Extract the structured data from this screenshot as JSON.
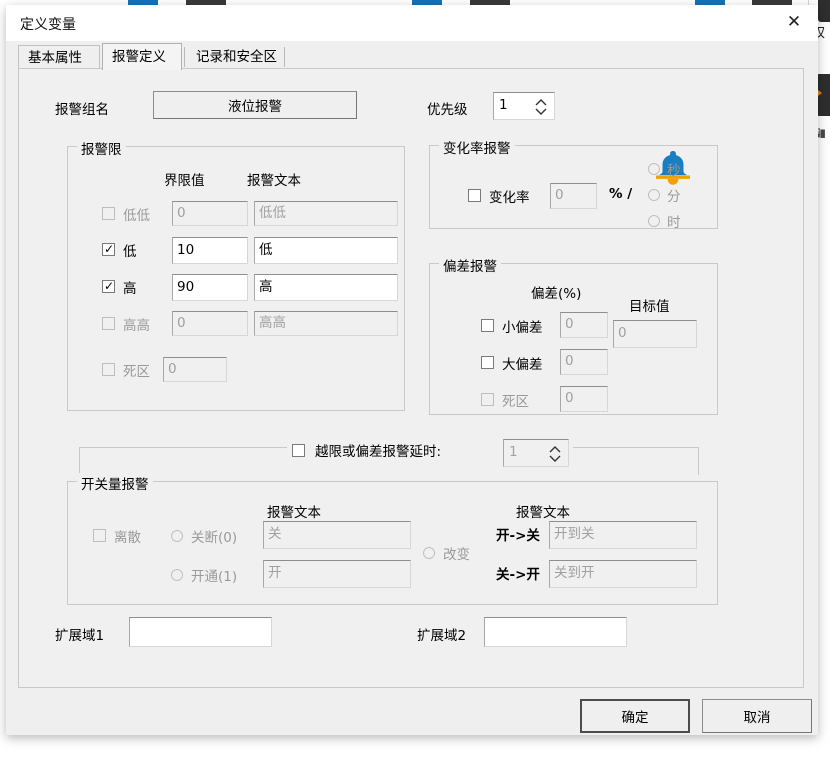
{
  "window": {
    "title": "定义变量",
    "close_icon": "close-icon"
  },
  "tabs": [
    {
      "label": "基本属性",
      "selected": false
    },
    {
      "label": "报警定义",
      "selected": true
    },
    {
      "label": "记录和安全区",
      "selected": false
    }
  ],
  "header": {
    "group_name_label": "报警组名",
    "group_name_button": "液位报警",
    "priority_label": "优先级",
    "priority_value": "1",
    "bell_icon": "bell-icon",
    "bell_top_color": "#1a7ec4",
    "bell_bottom_color": "#f2a007"
  },
  "alarm_limits": {
    "title": "报警限",
    "col_limit": "界限值",
    "col_text": "报警文本",
    "rows": [
      {
        "label": "低低",
        "checked": false,
        "enabled": false,
        "limit": "0",
        "text": "低低"
      },
      {
        "label": "低",
        "checked": true,
        "enabled": true,
        "limit": "10",
        "text": "低"
      },
      {
        "label": "高",
        "checked": true,
        "enabled": true,
        "limit": "90",
        "text": "高"
      },
      {
        "label": "高高",
        "checked": false,
        "enabled": false,
        "limit": "0",
        "text": "高高"
      }
    ],
    "deadband": {
      "label": "死区",
      "checked": false,
      "enabled": false,
      "value": "0"
    }
  },
  "rate_alarm": {
    "title": "变化率报警",
    "checkbox_label": "变化率",
    "checked": false,
    "value": "0",
    "unit_prefix": "% /",
    "options": [
      {
        "label": "秒",
        "selected": false
      },
      {
        "label": "分",
        "selected": false
      },
      {
        "label": "时",
        "selected": false
      }
    ]
  },
  "deviation_alarm": {
    "title": "偏差报警",
    "col_deviation": "偏差(%)",
    "col_target": "目标值",
    "target_value": "0",
    "rows": [
      {
        "label": "小偏差",
        "checked": false,
        "enabled": true,
        "value": "0"
      },
      {
        "label": "大偏差",
        "checked": false,
        "enabled": true,
        "value": "0"
      },
      {
        "label": "死区",
        "checked": false,
        "enabled": false,
        "value": "0"
      }
    ]
  },
  "delay": {
    "label": "越限或偏差报警延时:",
    "checked": false,
    "value": "1"
  },
  "discrete_alarm": {
    "title": "开关量报警",
    "checkbox_label": "离散",
    "checked": false,
    "col_text_left": "报警文本",
    "col_text_right": "报警文本",
    "radio_off": "关断(0)",
    "radio_on": "开通(1)",
    "radio_change": "改变",
    "text_off": "关",
    "text_on": "开",
    "label_on_to_off": "开->关",
    "label_off_to_on": "关->开",
    "text_on_to_off": "开到关",
    "text_off_to_on": "关到开"
  },
  "extensions": {
    "field1_label": "扩展域1",
    "field1_value": "",
    "field2_label": "扩展域2",
    "field2_value": ""
  },
  "footer": {
    "ok": "确定",
    "cancel": "取消"
  },
  "background": {
    "char": "权"
  }
}
